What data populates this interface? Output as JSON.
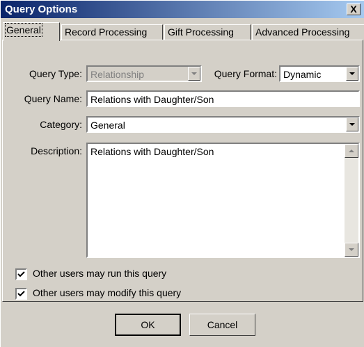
{
  "window": {
    "title": "Query Options"
  },
  "tabs": [
    {
      "label": "General",
      "active": true
    },
    {
      "label": "Record Processing",
      "active": false
    },
    {
      "label": "Gift Processing",
      "active": false
    },
    {
      "label": "Advanced Processing",
      "active": false
    }
  ],
  "form": {
    "query_type_label": "Query Type:",
    "query_type_value": "Relationship",
    "query_format_label": "Query Format:",
    "query_format_value": "Dynamic",
    "query_name_label": "Query Name:",
    "query_name_value": "Relations with Daughter/Son",
    "category_label": "Category:",
    "category_value": "General",
    "description_label": "Description:",
    "description_value": "Relations with Daughter/Son"
  },
  "options": [
    {
      "label": "Other users may run this query",
      "checked": true
    },
    {
      "label": "Other users may modify this query",
      "checked": true
    }
  ],
  "buttons": {
    "ok": "OK",
    "cancel": "Cancel"
  },
  "close_glyph": "X"
}
